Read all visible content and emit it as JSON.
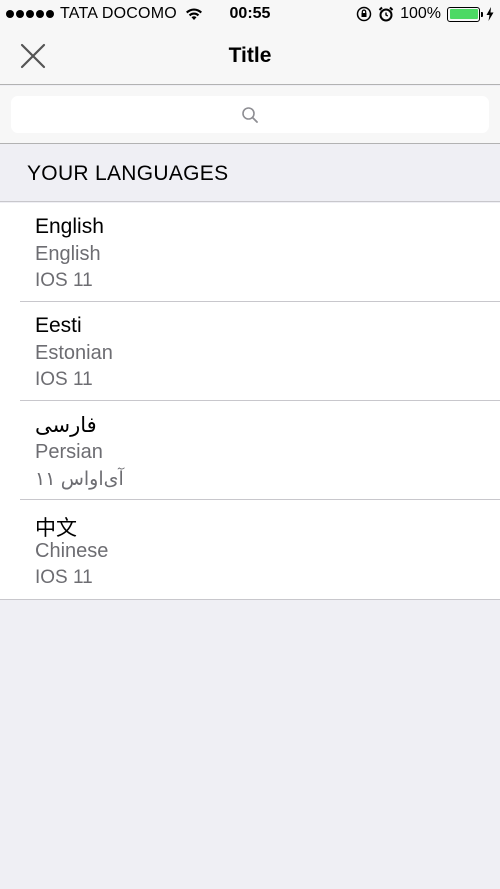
{
  "status_bar": {
    "carrier": "TATA DOCOMO",
    "time": "00:55",
    "battery": "100%",
    "battery_color": "#4cd964"
  },
  "nav": {
    "title": "Title",
    "close_icon": "close-icon"
  },
  "search": {
    "placeholder": "",
    "icon": "search-icon"
  },
  "section": {
    "title": "YOUR LANGUAGES"
  },
  "languages": [
    {
      "native": "English",
      "english": "English",
      "version": "IOS 11"
    },
    {
      "native": "Eesti",
      "english": "Estonian",
      "version": "IOS 11"
    },
    {
      "native": "فارسی",
      "english": "Persian",
      "version": "آی‌اواس ۱۱"
    },
    {
      "native": "中文",
      "english": "Chinese",
      "version": "IOS 11"
    }
  ]
}
